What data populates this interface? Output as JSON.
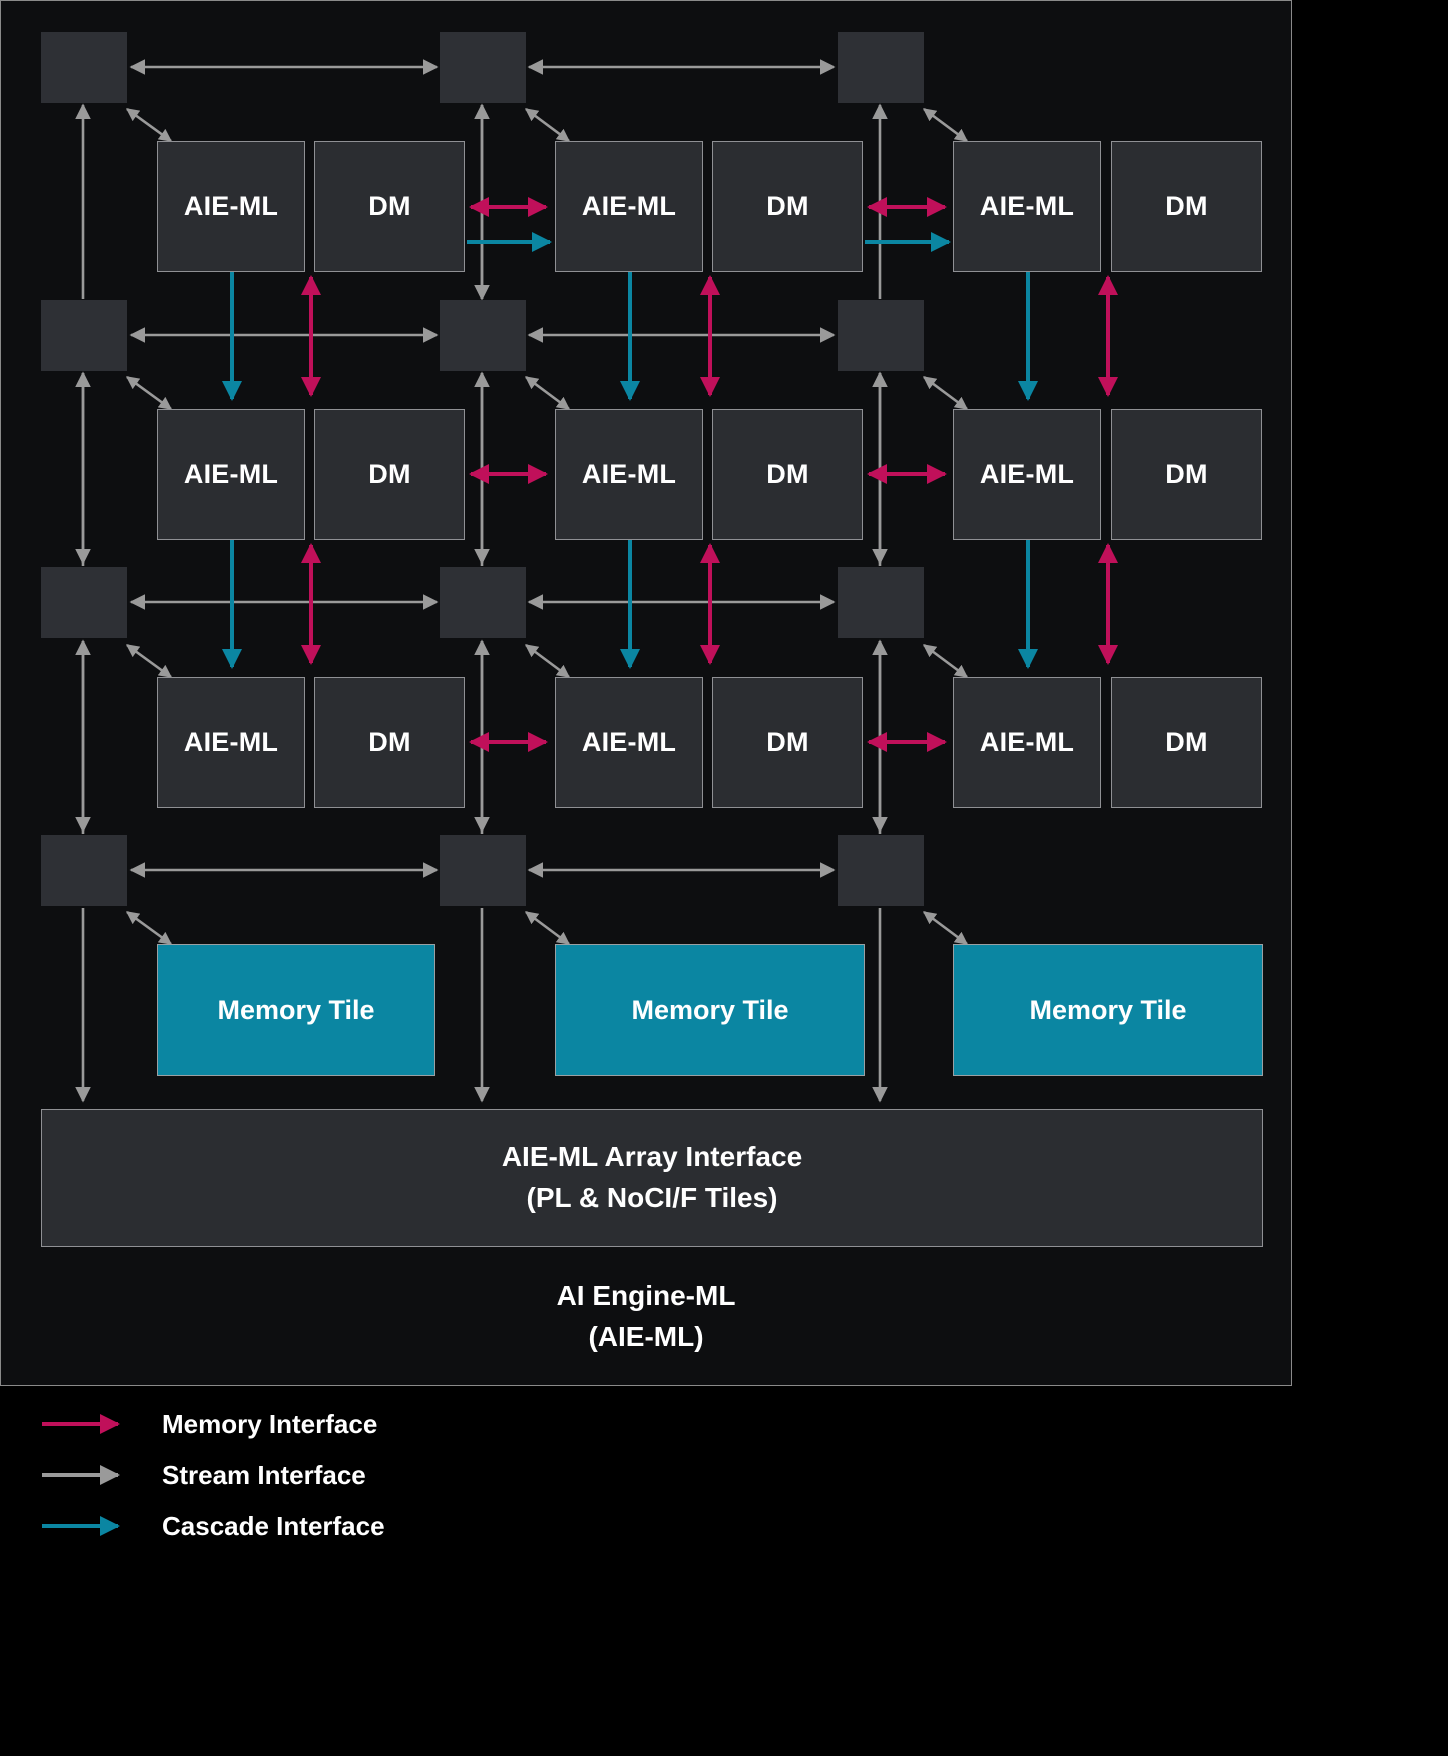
{
  "diagram": {
    "title_lines": [
      "AI Engine-ML",
      "(AIE-ML)"
    ],
    "array_interface_lines": [
      "AIE-ML Array Interface",
      "(PL & NoCI/F Tiles)"
    ],
    "tile_labels": {
      "engine": "AIE-ML",
      "memory": "DM",
      "memory_tile": "Memory Tile"
    },
    "grid": {
      "rows": 3,
      "cols": 3,
      "row_tiles": [
        [
          {
            "engine": "AIE-ML",
            "dm": "DM"
          },
          {
            "engine": "AIE-ML",
            "dm": "DM"
          },
          {
            "engine": "AIE-ML",
            "dm": "DM"
          }
        ],
        [
          {
            "engine": "AIE-ML",
            "dm": "DM"
          },
          {
            "engine": "AIE-ML",
            "dm": "DM"
          },
          {
            "engine": "AIE-ML",
            "dm": "DM"
          }
        ],
        [
          {
            "engine": "AIE-ML",
            "dm": "DM"
          },
          {
            "engine": "AIE-ML",
            "dm": "DM"
          },
          {
            "engine": "AIE-ML",
            "dm": "DM"
          }
        ]
      ],
      "memory_tiles": [
        "Memory Tile",
        "Memory Tile",
        "Memory Tile"
      ],
      "switch_rows": 4,
      "switch_cols": 3
    }
  },
  "legend": {
    "items": [
      {
        "label": "Memory Interface",
        "color": "#c0105a",
        "icon": "arrow-right-icon"
      },
      {
        "label": "Stream Interface",
        "color": "#9a9a9a",
        "icon": "arrow-right-icon"
      },
      {
        "label": "Cascade Interface",
        "color": "#0b86a2",
        "icon": "arrow-right-icon"
      }
    ]
  },
  "colors": {
    "memory_interface": "#c0105a",
    "stream_interface": "#9a9a9a",
    "cascade_interface": "#0b86a2",
    "memory_tile_fill": "#0b86a2",
    "tile_fill": "#2b2d31",
    "background": "#0d0e10"
  }
}
